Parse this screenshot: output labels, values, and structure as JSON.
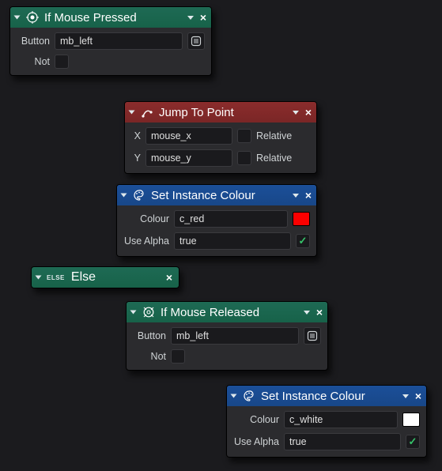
{
  "nodes": {
    "if_mouse_pressed": {
      "title": "If Mouse Pressed",
      "button_label": "Button",
      "button_value": "mb_left",
      "not_label": "Not",
      "not_checked": false
    },
    "jump_to_point": {
      "title": "Jump To Point",
      "x_label": "X",
      "x_value": "mouse_x",
      "x_relative_label": "Relative",
      "x_relative_checked": false,
      "y_label": "Y",
      "y_value": "mouse_y",
      "y_relative_label": "Relative",
      "y_relative_checked": false
    },
    "set_colour_1": {
      "title": "Set Instance Colour",
      "colour_label": "Colour",
      "colour_value": "c_red",
      "colour_swatch": "#fb0000",
      "use_alpha_label": "Use Alpha",
      "use_alpha_value": "true",
      "use_alpha_checked": true
    },
    "else": {
      "keyword": "ELSE",
      "title": "Else"
    },
    "if_mouse_released": {
      "title": "If Mouse Released",
      "button_label": "Button",
      "button_value": "mb_left",
      "not_label": "Not",
      "not_checked": false
    },
    "set_colour_2": {
      "title": "Set Instance Colour",
      "colour_label": "Colour",
      "colour_value": "c_white",
      "colour_swatch": "#ffffff",
      "use_alpha_label": "Use Alpha",
      "use_alpha_value": "true",
      "use_alpha_checked": true
    }
  }
}
